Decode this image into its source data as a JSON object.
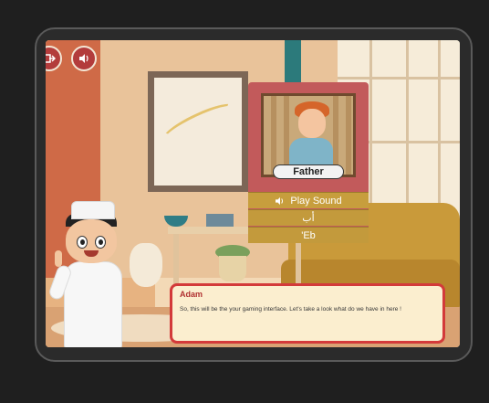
{
  "game": {
    "toolbar": {
      "exit_icon": "exit-icon",
      "sound_icon": "sound-icon"
    },
    "card": {
      "word": "Father",
      "play_sound_label": "Play Sound",
      "arabic_letter": "أب",
      "transliteration": "'Eb"
    },
    "dialog": {
      "speaker": "Adam",
      "message": "So, this will be the your gaming interface. Let's take a look what do we have in here !"
    }
  },
  "colors": {
    "card_bg": "#c25a5b",
    "card_row": "#c39a3c",
    "dialog_border": "#d33a3a",
    "dialog_bg": "#fbeecf"
  }
}
